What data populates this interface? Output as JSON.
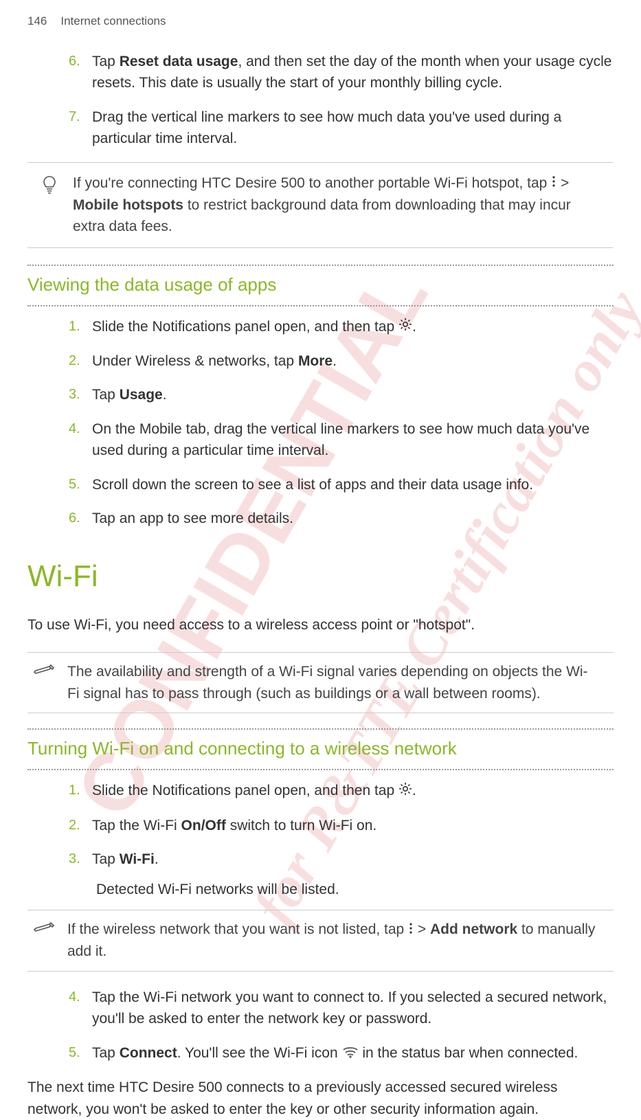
{
  "header": {
    "page_number": "146",
    "section": "Internet connections"
  },
  "steps_top": [
    {
      "num": "6.",
      "pre": "Tap ",
      "bold": "Reset data usage",
      "post": ", and then set the day of the month when your usage cycle resets. This date is usually the start of your monthly billing cycle."
    },
    {
      "num": "7.",
      "pre": "Drag the vertical line markers to see how much data you've used during a particular time interval.",
      "bold": "",
      "post": ""
    }
  ],
  "tip1": {
    "pre": "If you're connecting HTC Desire 500 to another portable Wi-Fi hotspot, tap ",
    "mid": " > ",
    "bold": "Mobile hotspots",
    "post": " to restrict background data from downloading that may incur extra data fees."
  },
  "subhead1": "Viewing the data usage of apps",
  "steps_viewing": [
    {
      "num": "1.",
      "text": "Slide the Notifications panel open, and then tap ",
      "icon": "gear",
      "post": "."
    },
    {
      "num": "2.",
      "pre": "Under Wireless & networks, tap ",
      "bold": "More",
      "post": "."
    },
    {
      "num": "3.",
      "pre": "Tap ",
      "bold": "Usage",
      "post": "."
    },
    {
      "num": "4.",
      "text": "On the Mobile tab, drag the vertical line markers to see how much data you've used during a particular time interval."
    },
    {
      "num": "5.",
      "text": "Scroll down the screen to see a list of apps and their data usage info."
    },
    {
      "num": "6.",
      "text": "Tap an app to see more details."
    }
  ],
  "main_heading": "Wi-Fi",
  "wifi_intro": "To use Wi-Fi, you need access to a wireless access point or \"hotspot\".",
  "note_wifi": "The availability and strength of a Wi-Fi signal varies depending on objects the Wi-Fi signal has to pass through (such as buildings or a wall between rooms).",
  "subhead2": "Turning Wi-Fi on and connecting to a wireless network",
  "steps_wifi": [
    {
      "num": "1.",
      "text": "Slide the Notifications panel open, and then tap ",
      "icon": "gear",
      "post": "."
    },
    {
      "num": "2.",
      "pre": "Tap the Wi-Fi ",
      "bold": "On/Off",
      "post": " switch to turn Wi-Fi on."
    },
    {
      "num": "3.",
      "pre": "Tap ",
      "bold": "Wi-Fi",
      "post": "."
    }
  ],
  "step3_result": "Detected Wi-Fi networks will be listed.",
  "note_addnet": {
    "pre": "If the wireless network that you want is not listed, tap ",
    "mid": " > ",
    "bold": "Add network",
    "post": " to manually add it."
  },
  "steps_wifi2": [
    {
      "num": "4.",
      "text": "Tap the Wi-Fi network you want to connect to. If you selected a secured network, you'll be asked to enter the network key or password."
    },
    {
      "num": "5.",
      "pre": "Tap ",
      "bold": "Connect",
      "post_a": ". You'll see the Wi-Fi icon ",
      "icon": "wifi",
      "post_b": " in the status bar when connected."
    }
  ],
  "closing": "The next time HTC Desire 500 connects to a previously accessed secured wireless network, you won't be asked to enter the key or other security information again."
}
